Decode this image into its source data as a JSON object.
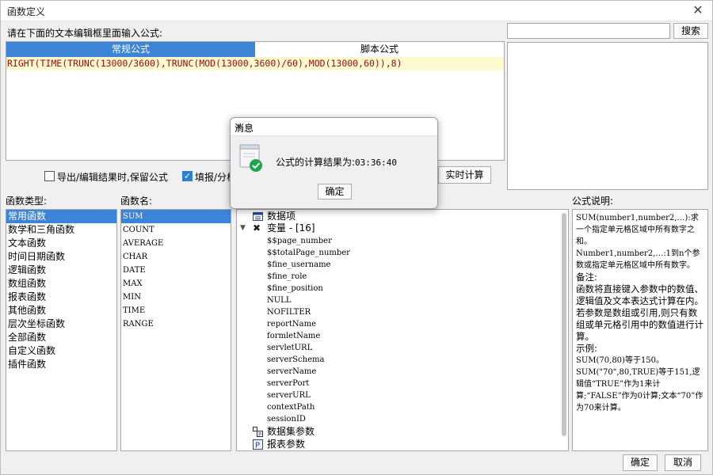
{
  "window": {
    "title": "函数定义",
    "close_icon": "close-icon"
  },
  "prompt_label": "请在下面的文本编辑框里面输入公式:",
  "formula_tabs": [
    {
      "label": "常规公式",
      "active": true
    },
    {
      "label": "脚本公式",
      "active": false
    }
  ],
  "formula_text": "RIGHT(TIME(TRUNC(13000/3600),TRUNC(MOD(13000,3600)/60),MOD(13000,60)),8)",
  "search": {
    "value": "",
    "button_label": "搜索"
  },
  "options": {
    "keep_formula_label": "导出/编辑结果时,保留公式",
    "keep_formula_checked": false,
    "fill_label": "填报/分析",
    "fill_checked": true,
    "realtime_button": "实时计算"
  },
  "function_types": {
    "heading": "函数类型:",
    "items": [
      "常用函数",
      "数学和三角函数",
      "文本函数",
      "时间日期函数",
      "逻辑函数",
      "数组函数",
      "报表函数",
      "其他函数",
      "层次坐标函数",
      "全部函数",
      "自定义函数",
      "插件函数"
    ],
    "selected_index": 0
  },
  "function_names": {
    "heading": "函数名:",
    "items": [
      "SUM",
      "COUNT",
      "AVERAGE",
      "CHAR",
      "DATE",
      "MAX",
      "MIN",
      "TIME",
      "RANGE"
    ],
    "selected_index": 0
  },
  "tree": {
    "data_item_label": "数据项",
    "variables_label": "变量 - [16]",
    "variables": [
      "$$page_number",
      "$$totalPage_number",
      "$fine_username",
      "$fine_role",
      "$fine_position",
      "NULL",
      "NOFILTER",
      "reportName",
      "formletName",
      "servletURL",
      "serverSchema",
      "serverName",
      "serverPort",
      "serverURL",
      "contextPath",
      "sessionID"
    ],
    "dataset_params_label": "数据集参数",
    "report_params_label": "报表参数"
  },
  "description": {
    "heading": "公式说明:",
    "paragraphs": [
      {
        "text": "SUM(number1,number2,…):求一个指定单元格区域中所有数字之和。",
        "mono": true
      },
      {
        "text": "Number1,number2,…:1到n个参数或指定单元格区域中所有数字。",
        "mono": true
      },
      {
        "text": "备注:",
        "mono": false
      },
      {
        "text": "函数将直接键入参数中的数值、逻辑值及文本表达式计算在内。若参数是数组或引用,则只有数组或单元格引用中的数值进行计算。",
        "mono": false
      },
      {
        "text": "示例:",
        "mono": false
      },
      {
        "text": "SUM(70,80)等于150。",
        "mono": true
      },
      {
        "text": "SUM(\"70\",80,TRUE)等于151,逻辑值“TRUE”作为1来计算;“FALSE”作为0计算;文本“70”作为70来计算。",
        "mono": true
      }
    ]
  },
  "footer": {
    "ok": "确定",
    "cancel": "取消"
  },
  "message_dialog": {
    "title": "消息",
    "message_prefix": "公式的计算结果为:",
    "message_value": "03:36:40",
    "ok": "确定",
    "icon": "success-check-icon"
  },
  "colors": {
    "accent": "#3b84d8",
    "formula_bg": "#fffbd0",
    "formula_text": "#a10b0b",
    "success": "#1fa54a"
  }
}
